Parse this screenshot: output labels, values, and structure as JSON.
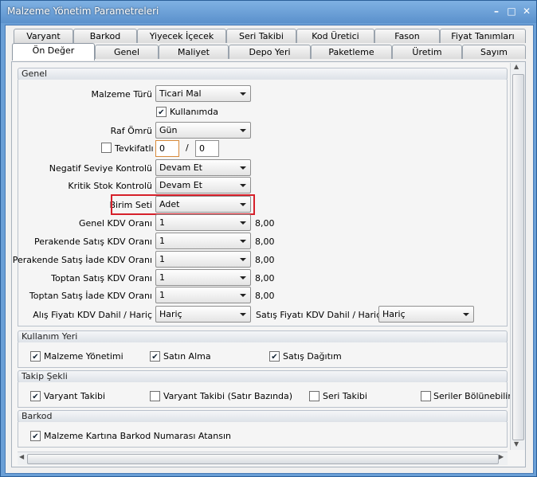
{
  "window": {
    "title": "Malzeme Yönetim Parametreleri"
  },
  "tabs_row1": [
    "Varyant",
    "Barkod",
    "Yiyecek İçecek",
    "Seri Takibi",
    "Kod Üretici",
    "Fason",
    "Fiyat Tanımları"
  ],
  "tabs_row2": [
    "Ön Değer",
    "Genel",
    "Maliyet",
    "Depo Yeri",
    "Paketleme",
    "Üretim",
    "Sayım"
  ],
  "genel": {
    "section_title": "Genel",
    "malzeme_turu_label": "Malzeme Türü",
    "malzeme_turu_value": "Ticari Mal",
    "kullanimda_label": "Kullanımda",
    "raf_omru_label": "Raf Ömrü",
    "raf_omru_value": "Gün",
    "tevkifatli_label": "Tevkifatlı",
    "tevkifat_num": "0",
    "tevkifat_sep": "/",
    "tevkifat_den": "0",
    "negatif_label": "Negatif Seviye Kontrolü",
    "negatif_value": "Devam Et",
    "kritik_label": "Kritik Stok Kontrolü",
    "kritik_value": "Devam Et",
    "birim_label": "Birim Seti",
    "birim_value": "Adet",
    "kdv_rows": [
      {
        "label": "Genel KDV Oranı",
        "value": "1",
        "rate": "8,00"
      },
      {
        "label": "Perakende Satış KDV Oranı",
        "value": "1",
        "rate": "8,00"
      },
      {
        "label": "Perakende Satış İade KDV Oranı",
        "value": "1",
        "rate": "8,00"
      },
      {
        "label": "Toptan Satış KDV Oranı",
        "value": "1",
        "rate": "8,00"
      },
      {
        "label": "Toptan Satış İade KDV Oranı",
        "value": "1",
        "rate": "8,00"
      }
    ],
    "alis_label": "Alış Fiyatı KDV Dahil / Hariç",
    "alis_value": "Hariç",
    "satis_label": "Satış Fiyatı KDV Dahil / Hariç",
    "satis_value": "Hariç"
  },
  "kullanim": {
    "section_title": "Kullanım Yeri",
    "items": [
      "Malzeme Yönetimi",
      "Satın Alma",
      "Satış Dağıtım"
    ]
  },
  "takip": {
    "section_title": "Takip Şekli",
    "items": [
      "Varyant Takibi",
      "Varyant Takibi (Satır Bazında)",
      "Seri Takibi",
      "Seriler Bölünebilir"
    ]
  },
  "barkod": {
    "section_title": "Barkod",
    "item": "Malzeme Kartına Barkod Numarası Atansın"
  }
}
